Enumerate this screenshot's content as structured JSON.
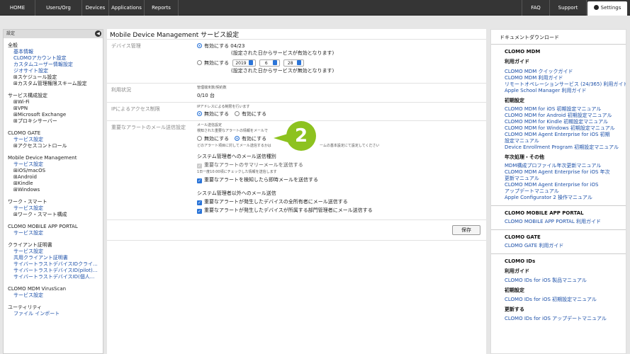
{
  "topnav": {
    "home": "HOME",
    "users": "Users/Org",
    "devices": "Devices",
    "applications": "Applications",
    "reports": "Reports",
    "faq": "FAQ",
    "support": "Support",
    "settings": "Settings"
  },
  "sidebar": {
    "header": "設定",
    "general": "全般",
    "general_items": [
      "基本情報",
      "CLOMOアカウント設定",
      "カスタムユーザー情報設定",
      "ジオサイト設定"
    ],
    "general_exp": [
      "⊞スケジュール設定",
      "⊞カスタム管理権限スキーム設定"
    ],
    "service": "サービス構成設定",
    "service_exp": [
      "⊞Wi-Fi",
      "⊞VPN",
      "⊞Microsoft Exchange",
      "⊞プロキシサーバー"
    ],
    "gate": "CLOMO GATE",
    "gate_link": "サービス設定",
    "gate_exp": "⊞アクセスコントロール",
    "mdm": "Mobile Device Management",
    "mdm_link": "サービス設定",
    "mdm_exp": [
      "⊞iOS/macOS",
      "⊞Android",
      "⊞Kindle",
      "⊞Windows"
    ],
    "work": "ワーク・スマート",
    "work_link": "サービス設定",
    "work_exp": "⊞ワーク・スマート構成",
    "portal": "CLOMO MOBILE APP PORTAL",
    "portal_link": "サービス設定",
    "cert": "クライアント証明書",
    "cert_links": [
      "サービス設定",
      "共用クライアント証明書",
      "サイバートラストデバイスIDクライ...",
      "サイバートラストデバイスID(pilot)...",
      "サイバートラストデバイスID(個人..."
    ],
    "virus": "CLOMO MDM VirusScan",
    "virus_link": "サービス設定",
    "util": "ユーティリティ",
    "util_link": "ファイル インポート"
  },
  "main": {
    "title": "Mobile Device Management サービス設定",
    "device_mgmt": "デバイス管理",
    "enable_date": "有効にする 04/23",
    "enable_note": "(設定された日からサービスが有効となります)",
    "disable_label": "無効にする",
    "year": "2019",
    "month": "6",
    "day": "28",
    "disable_note": "(設定された日からサービスが無効となります)",
    "usage": "利用状況",
    "usage_head": "管理端末数/契約数",
    "usage_val": "0/10 台",
    "ip": "IPによるアクセス制限",
    "ip_note": "IPアドレスによる制限を行います",
    "ip_disable": "無効にする",
    "ip_enable": "有効にする",
    "alert": "重要なアラートのメール送信設定",
    "alert_head": "メール送信設定",
    "alert_note1": "検知された重要なアラートの情報をメールで",
    "alert_disable": "無効にする",
    "alert_enable": "有効にする",
    "alert_note2": "どのアラート項目に対してメール送信するかは",
    "alert_note2b": "ームの基本設定にて設定してください",
    "admin_head": "システム管理者へのメール送信種別",
    "summary": "重要なアラートのサマリーメールを送信する",
    "summary_note": "1日一度10:00頃にチェックした情報を送信します",
    "immediate": "重要なアラートを検知したら即時メールを送信する",
    "non_admin_head": "システム管理者以外へのメール送信",
    "owner": "重要なアラートが発生したデバイスの全所有者にメール送信する",
    "dept": "重要なアラートが発生したデバイスが所属する部門管理者にメール送信する",
    "save": "保存",
    "badge": "2"
  },
  "right": {
    "header": "ドキュメントダウンロード",
    "mdm": "CLOMO MDM",
    "guide": "利用ガイド",
    "guide_links": [
      "CLOMO MDM クイックガイド",
      "CLOMO MDM 利用ガイド",
      "リモートオペレーションサービス (24/365) 利用ガイド",
      "Apple School Manager 利用ガイド"
    ],
    "init": "初期設定",
    "init_links": [
      "CLOMO MDM for iOS 初期設定マニュアル",
      "CLOMO MDM for Android 初期設定マニュアル",
      "CLOMO MDM for Kindle 初期設定マニュアル",
      "CLOMO MDM for Windows 初期設定マニュアル",
      "CLOMO MDM Agent Enterprise for iOS 初期",
      "設定マニュアル",
      "Device Enrollment Program 初期設定マニュアル"
    ],
    "yearly": "年次処理・その他",
    "yearly_links": [
      "MDM構成プロファイル年次更新マニュアル",
      "CLOMO MDM Agent Enterprise for iOS 年次",
      "更新マニュアル",
      "CLOMO MDM Agent Enterprise for iOS",
      "アップデートマニュアル",
      "Apple Configurator 2 操作マニュアル"
    ],
    "portal": "CLOMO MOBILE APP PORTAL",
    "portal_link": "CLOMO MOBILE APP PORTAL 利用ガイド",
    "gate": "CLOMO GATE",
    "gate_link": "CLOMO GATE 利用ガイド",
    "ids": "CLOMO IDs",
    "ids_guide": "利用ガイド",
    "ids_guide_link": "CLOMO IDs for iOS 製品マニュアル",
    "ids_init": "初期設定",
    "ids_init_link": "CLOMO IDs for iOS 初期設定マニュアル",
    "ids_update": "更新する",
    "ids_update_link": "CLOMO IDs for iOS アップデートマニュアル"
  }
}
